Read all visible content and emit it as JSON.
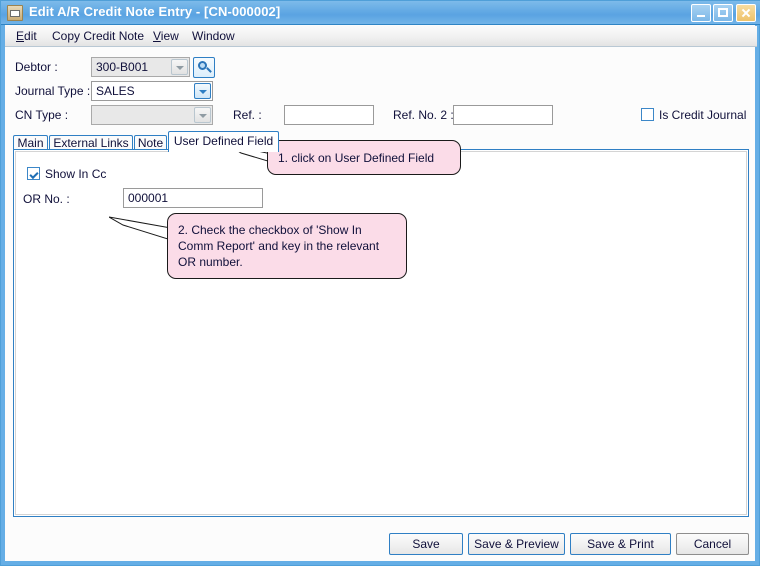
{
  "window": {
    "title": "Edit A/R Credit Note Entry - [CN-000002]",
    "icon": "document-envelope-icon",
    "controls": {
      "minimize": "Minimize",
      "maximize": "Maximize",
      "close": "Close"
    },
    "colors": {
      "titlebar": "#62a9e4",
      "frame": "#65aee6",
      "accent_border": "#2f7fc4",
      "callout_fill": "#fbdce8"
    }
  },
  "menubar": {
    "items": [
      {
        "label": "Edit",
        "accel": "E"
      },
      {
        "label": "Copy Credit Note",
        "accel": ""
      },
      {
        "label": "View",
        "accel": "V"
      },
      {
        "label": "Window",
        "accel": ""
      }
    ]
  },
  "form": {
    "debtor": {
      "label": "Debtor :",
      "value": "300-B001",
      "search_button": "search-icon"
    },
    "journal_type": {
      "label": "Journal Type :",
      "value": "SALES"
    },
    "cn_type": {
      "label": "CN Type :",
      "value": ""
    },
    "ref": {
      "label": "Ref. :",
      "value": ""
    },
    "ref_no_2": {
      "label": "Ref. No. 2 :",
      "value": ""
    },
    "is_credit_journal": {
      "label": "Is Credit Journal",
      "checked": false
    }
  },
  "tabs": [
    {
      "label": "Main",
      "active": false
    },
    {
      "label": "External Links",
      "active": false
    },
    {
      "label": "Note",
      "active": false
    },
    {
      "label": "User Defined Field",
      "active": true
    }
  ],
  "panel": {
    "show_in_comm_report": {
      "label": "Show In Cc",
      "checked": true
    },
    "or_no": {
      "label": "OR No. :",
      "value": "000001"
    }
  },
  "callouts": [
    {
      "text": "1. click on User Defined Field"
    },
    {
      "text": "2. Check the checkbox of 'Show In\nComm Report' and key in the relevant\nOR number."
    }
  ],
  "footer": {
    "buttons": [
      {
        "label": "Save",
        "focused": true
      },
      {
        "label": "Save & Preview",
        "focused": true
      },
      {
        "label": "Save & Print",
        "focused": true
      },
      {
        "label": "Cancel",
        "focused": false
      }
    ]
  }
}
